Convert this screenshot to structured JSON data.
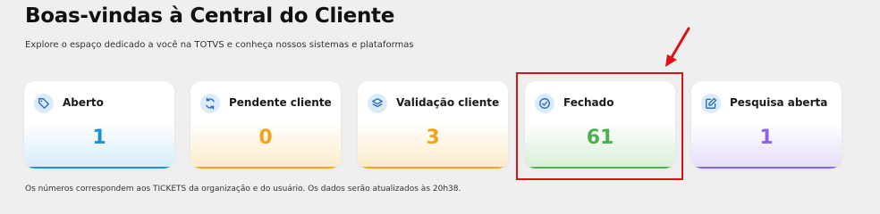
{
  "header": {
    "title": "Boas-vindas à Central do Cliente",
    "subtitle": "Explore o espaço dedicado a você na TOTVS e conheça nossos sistemas e plataformas"
  },
  "cards": [
    {
      "label": "Aberto",
      "count": "1",
      "icon": "tag-icon",
      "accent": "#1a90db",
      "fade": "#d6ecf8"
    },
    {
      "label": "Pendente cliente",
      "count": "0",
      "icon": "refresh-icon",
      "accent": "#f5a21b",
      "fade": "#fcebc8"
    },
    {
      "label": "Validação cliente",
      "count": "3",
      "icon": "layers-icon",
      "accent": "#f5a21b",
      "fade": "#fcebc8"
    },
    {
      "label": "Fechado",
      "count": "61",
      "icon": "check-circle-icon",
      "accent": "#4caf50",
      "fade": "#d8efd7"
    },
    {
      "label": "Pesquisa aberta",
      "count": "1",
      "icon": "edit-icon",
      "accent": "#8a63e6",
      "fade": "#e6ddfa"
    }
  ],
  "footnote": "Os números correspondem aos TICKETS da organização e do usuário. Os dados serão atualizados às 20h38.",
  "annotation": {
    "color": "#e10f16",
    "highlighted_card": "Fechado"
  }
}
